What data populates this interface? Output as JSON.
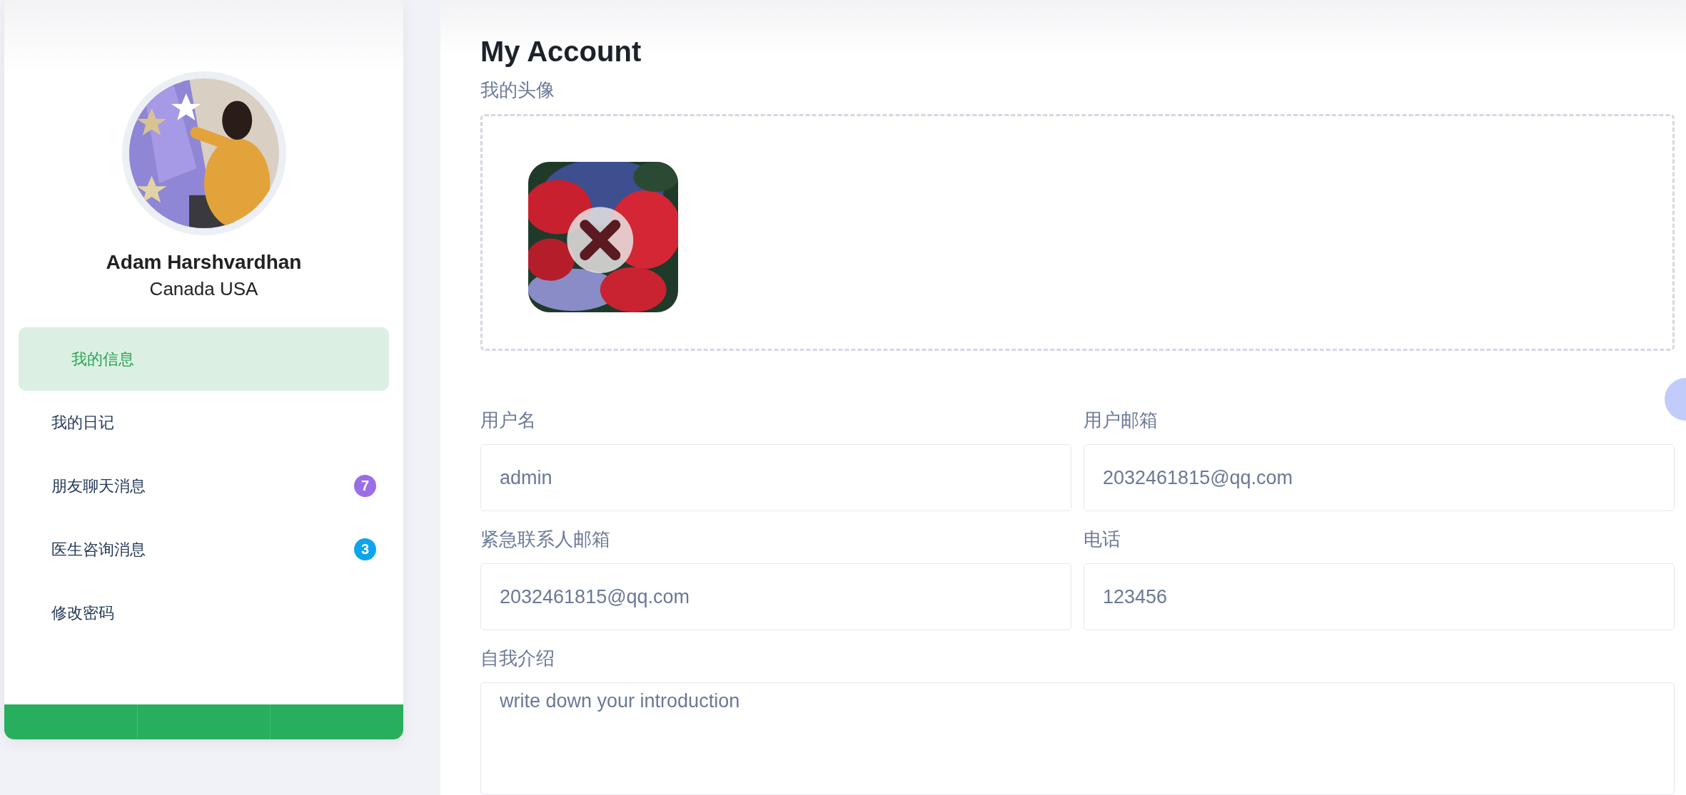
{
  "profile": {
    "name": "Adam Harshvardhan",
    "location": "Canada USA"
  },
  "menu": [
    {
      "label": "我的信息",
      "selected": true
    },
    {
      "label": "我的日记",
      "selected": false
    },
    {
      "label": "朋友聊天消息",
      "selected": false,
      "badge": "7",
      "color": "#9a6ee6"
    },
    {
      "label": "医生咨询消息",
      "selected": false,
      "badge": "3",
      "color": "#0ea5ec"
    },
    {
      "label": "修改密码",
      "selected": false
    }
  ],
  "page": {
    "title": "My Account",
    "avatar_label": "我的头像"
  },
  "fields": [
    {
      "label": "用户名",
      "value": "admin"
    },
    {
      "label": "用户邮箱",
      "value": "2032461815@qq.com"
    },
    {
      "label": "紧急联系人邮箱",
      "value": "2032461815@qq.com"
    },
    {
      "label": "电话",
      "value": "123456"
    }
  ],
  "intro": {
    "label": "自我介绍",
    "placeholder": "write down your introduction"
  }
}
